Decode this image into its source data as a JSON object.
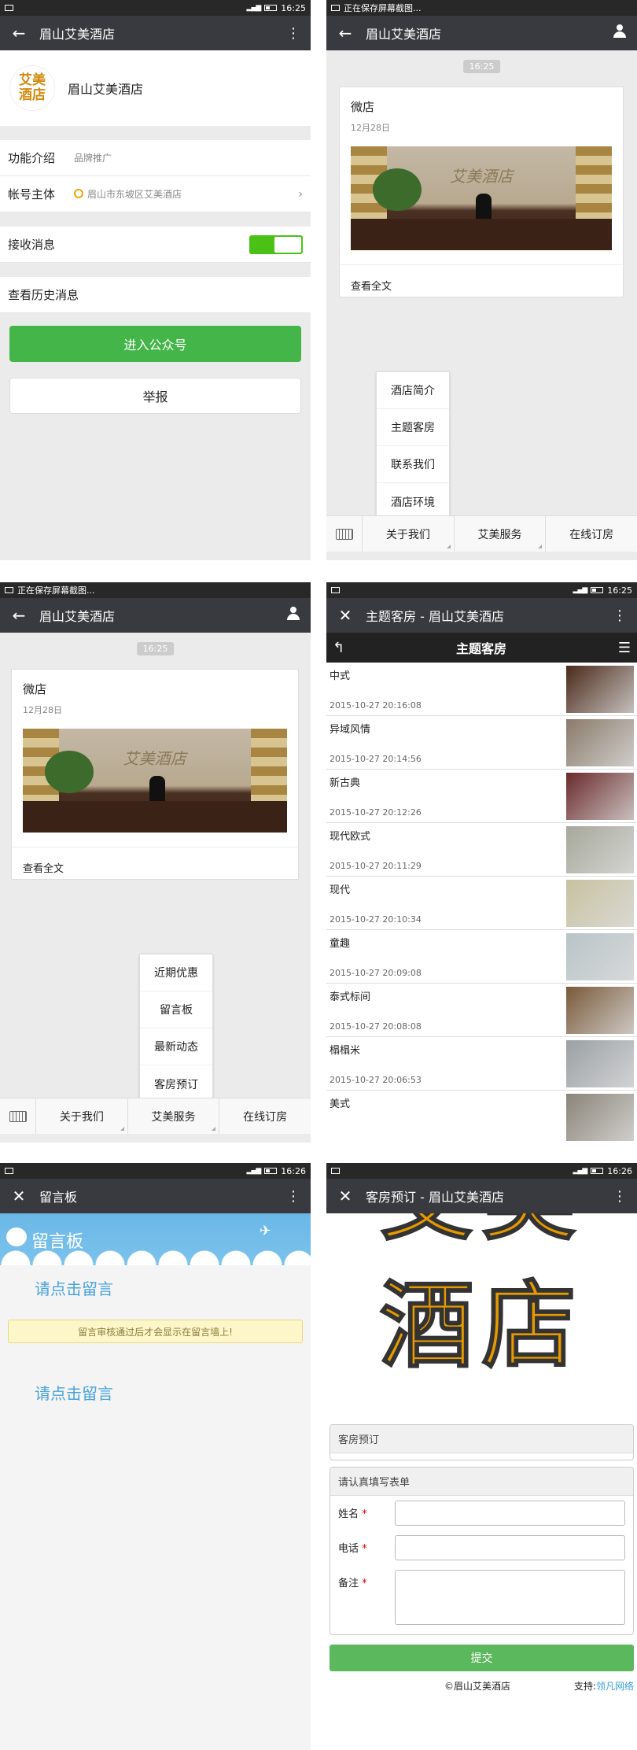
{
  "status": {
    "time1": "16:25",
    "time4": "16:25",
    "time5": "16:26",
    "time6": "16:26",
    "saving": "正在保存屏幕截图..."
  },
  "screen1": {
    "title": "眉山艾美酒店",
    "logo_line1": "艾美",
    "logo_line2": "酒店",
    "name": "眉山艾美酒店",
    "intro_label": "功能介绍",
    "intro_value": "品牌推广",
    "owner_label": "帐号主体",
    "owner_value": "眉山市东坡区艾美酒店",
    "receive_label": "接收消息",
    "history_label": "查看历史消息",
    "enter_button": "进入公众号",
    "report_button": "举报"
  },
  "screen2": {
    "title": "眉山艾美酒店",
    "time": "16:25",
    "card_title": "微店",
    "card_date": "12月28日",
    "card_sign": "艾美酒店",
    "card_more": "查看全文",
    "popup": [
      "酒店简介",
      "主题客房",
      "联系我们",
      "酒店环境"
    ],
    "menu": [
      "关于我们",
      "艾美服务",
      "在线订房"
    ]
  },
  "screen3": {
    "title": "眉山艾美酒店",
    "time": "16:25",
    "card_title": "微店",
    "card_date": "12月28日",
    "card_sign": "艾美酒店",
    "card_more": "查看全文",
    "popup": [
      "近期优惠",
      "留言板",
      "最新动态",
      "客房预订"
    ],
    "menu": [
      "关于我们",
      "艾美服务",
      "在线订房"
    ]
  },
  "screen4": {
    "title": "主题客房 - 眉山艾美酒店",
    "subtitle": "主题客房",
    "rooms": [
      {
        "name": "中式",
        "date": "2015-10-27 20:16:08",
        "color": "#4a2a1a"
      },
      {
        "name": "异域风情",
        "date": "2015-10-27 20:14:56",
        "color": "#8a7a6a"
      },
      {
        "name": "新古典",
        "date": "2015-10-27 20:12:26",
        "color": "#6a2a2a"
      },
      {
        "name": "现代欧式",
        "date": "2015-10-27 20:11:29",
        "color": "#a6a89a"
      },
      {
        "name": "现代",
        "date": "2015-10-27 20:10:34",
        "color": "#c8c2a0"
      },
      {
        "name": "童趣",
        "date": "2015-10-27 20:09:08",
        "color": "#b8c4c8"
      },
      {
        "name": "泰式标间",
        "date": "2015-10-27 20:08:08",
        "color": "#7a5a3a"
      },
      {
        "name": "榻榻米",
        "date": "2015-10-27 20:06:53",
        "color": "#9aa0a4"
      },
      {
        "name": "美式",
        "date": "",
        "color": "#8a8478"
      }
    ]
  },
  "screen5": {
    "title": "留言板",
    "banner": "留言板",
    "link1": "请点击留言",
    "notice": "留言审核通过后才会显示在留言墙上!",
    "link2": "请点击留言"
  },
  "screen6": {
    "title": "客房预订 - 眉山艾美酒店",
    "big_top": "艾美",
    "big_bottom": "酒店",
    "panel1": "客房预订",
    "panel2": "请认真填写表单",
    "name_label": "姓名",
    "phone_label": "电话",
    "note_label": "备注",
    "required": "*",
    "submit": "提交",
    "copyright": "©眉山艾美酒店",
    "support_label": "支持:",
    "support_link": "领凡网络"
  }
}
